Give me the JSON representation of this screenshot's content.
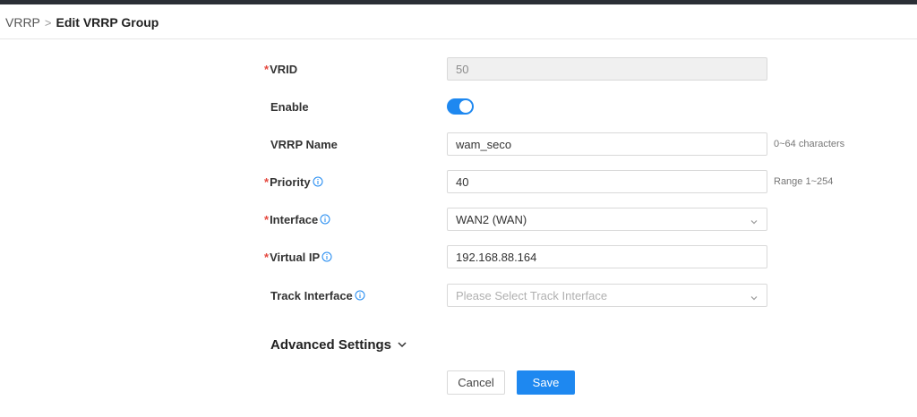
{
  "breadcrumb": {
    "parent": "VRRP",
    "separator": ">",
    "current": "Edit VRRP Group"
  },
  "form": {
    "vrid": {
      "label": "VRID",
      "required": true,
      "value": "50"
    },
    "enable": {
      "label": "Enable",
      "checked": true
    },
    "vrrp_name": {
      "label": "VRRP Name",
      "value": "wam_seco",
      "hint": "0~64 characters"
    },
    "priority": {
      "label": "Priority",
      "required": true,
      "value": "40",
      "hint": "Range 1~254"
    },
    "interface": {
      "label": "Interface",
      "required": true,
      "value": "WAN2 (WAN)"
    },
    "virtual_ip": {
      "label": "Virtual IP",
      "required": true,
      "value": "192.168.88.164"
    },
    "track_interface": {
      "label": "Track Interface",
      "placeholder": "Please Select Track Interface"
    }
  },
  "advanced": {
    "label": "Advanced Settings"
  },
  "buttons": {
    "cancel": "Cancel",
    "save": "Save"
  },
  "colors": {
    "accent": "#1e88f0",
    "required": "#e5483e",
    "disabled_bg": "#f0f0f0",
    "topbar": "#2b2f36"
  },
  "icons": {
    "info": "info-circle-icon",
    "chevron": "chevron-down-icon"
  }
}
